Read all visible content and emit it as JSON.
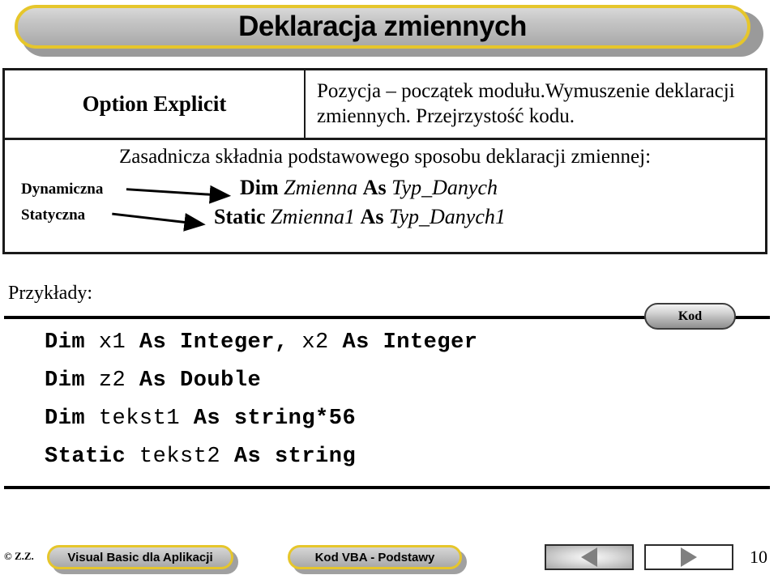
{
  "slide": {
    "title": "Deklaracja zmiennych",
    "page_number": "10"
  },
  "table": {
    "row1": {
      "term": "Option Explicit",
      "description": "Pozycja – początek modułu.Wymuszenie deklaracji zmiennych. Przejrzystość kodu."
    },
    "row2": {
      "heading": "Zasadnicza składnia podstawowego sposobu deklaracji zmiennej:",
      "label_dynamic": "Dynamiczna",
      "label_static": "Statyczna",
      "syntax_dynamic": {
        "keyword1": "Dim",
        "variable": "Zmienna",
        "keyword2": "As",
        "type": "Typ_Danych"
      },
      "syntax_static": {
        "keyword1": "Static",
        "variable": "Zmienna1",
        "keyword2": "As",
        "type": "Typ_Danych1"
      }
    }
  },
  "examples": {
    "label": "Przykłady:",
    "badge": "Kod",
    "lines": [
      {
        "parts": [
          {
            "t": "Dim ",
            "b": true
          },
          {
            "t": "x1 ",
            "b": false
          },
          {
            "t": "As Integer,",
            "b": true
          },
          {
            "t": " x2 ",
            "b": false
          },
          {
            "t": "As Integer",
            "b": true
          }
        ]
      },
      {
        "parts": [
          {
            "t": "Dim ",
            "b": true
          },
          {
            "t": "z2 ",
            "b": false
          },
          {
            "t": "As Double",
            "b": true
          }
        ]
      },
      {
        "parts": [
          {
            "t": "Dim ",
            "b": true
          },
          {
            "t": "tekst1 ",
            "b": false
          },
          {
            "t": "As string*56",
            "b": true
          }
        ]
      },
      {
        "parts": [
          {
            "t": "Static ",
            "b": true
          },
          {
            "t": "tekst2 ",
            "b": false
          },
          {
            "t": "As string",
            "b": true
          }
        ]
      }
    ]
  },
  "footer": {
    "copyright": "© Z.Z.",
    "pill_course": "Visual Basic dla Aplikacji",
    "pill_topic": "Kod VBA - Podstawy",
    "nav_back": "back-triangle",
    "nav_forward": "forward-triangle"
  },
  "colors": {
    "gold_border": "#e6c62b",
    "banner_gray": "#c4c4c4",
    "rule_black": "#000000"
  }
}
